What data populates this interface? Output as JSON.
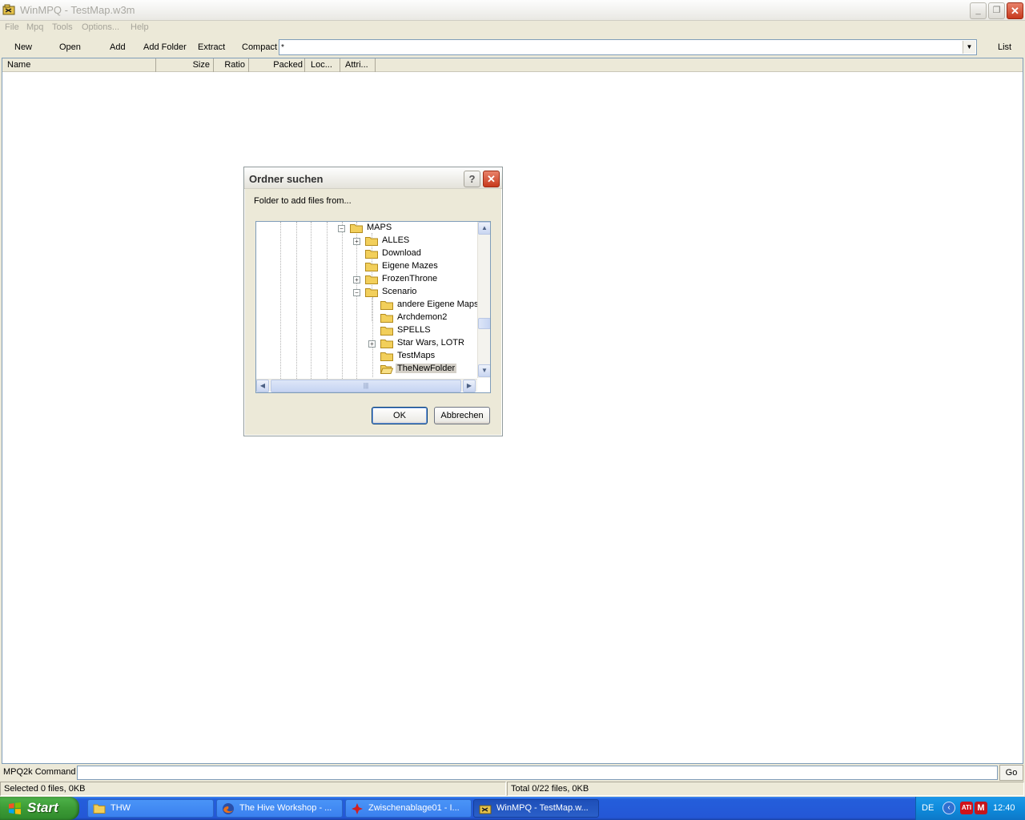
{
  "window": {
    "title": "WinMPQ - TestMap.w3m",
    "minimize_label": "_",
    "maximize_label": "❐",
    "close_label": "✕"
  },
  "menu": [
    "File",
    "Mpq",
    "Tools",
    "Options...",
    "Help"
  ],
  "toolbar": {
    "new": "New",
    "open": "Open",
    "add": "Add",
    "add_folder": "Add Folder",
    "extract": "Extract",
    "compact": "Compact",
    "mask_value": "*",
    "list": "List"
  },
  "file_list": {
    "columns": [
      "Name",
      "Size",
      "Ratio",
      "Packed",
      "Loc...",
      "Attri..."
    ],
    "rows": []
  },
  "command_bar": {
    "label": "MPQ2k Command",
    "value": "",
    "go": "Go"
  },
  "status": {
    "selected": "Selected 0 files, 0KB",
    "total": "Total 0/22 files, 0KB"
  },
  "dialog": {
    "title": "Ordner suchen",
    "help": "?",
    "close": "✕",
    "description": "Folder to add files from...",
    "tree": [
      {
        "label": "MAPS",
        "expander": "−"
      },
      {
        "label": "ALLES",
        "expander": "+"
      },
      {
        "label": "Download",
        "expander": ""
      },
      {
        "label": "Eigene Mazes",
        "expander": ""
      },
      {
        "label": "FrozenThrone",
        "expander": "+"
      },
      {
        "label": "Scenario",
        "expander": "−"
      },
      {
        "label": "andere Eigene Maps",
        "expander": ""
      },
      {
        "label": "Archdemon2",
        "expander": ""
      },
      {
        "label": "SPELLS",
        "expander": ""
      },
      {
        "label": "Star Wars, LOTR",
        "expander": "+"
      },
      {
        "label": "TestMaps",
        "expander": ""
      },
      {
        "label": "TheNewFolder",
        "expander": "",
        "selected": true
      }
    ],
    "ok": "OK",
    "cancel": "Abbrechen"
  },
  "taskbar": {
    "start": "Start",
    "tasks": [
      {
        "label": "THW",
        "icon": "folder-icon"
      },
      {
        "label": "The Hive Workshop - ...",
        "icon": "firefox-icon"
      },
      {
        "label": "Zwischenablage01 - I...",
        "icon": "paint-icon"
      },
      {
        "label": "WinMPQ - TestMap.w...",
        "icon": "winmpq-icon",
        "active": true
      }
    ],
    "language": "DE",
    "clock": "12:40"
  },
  "colors": {
    "accent": "#245edb",
    "start_green": "#3c9b36",
    "close_red": "#c7391d",
    "folder_yellow": "#f2cf5b"
  }
}
